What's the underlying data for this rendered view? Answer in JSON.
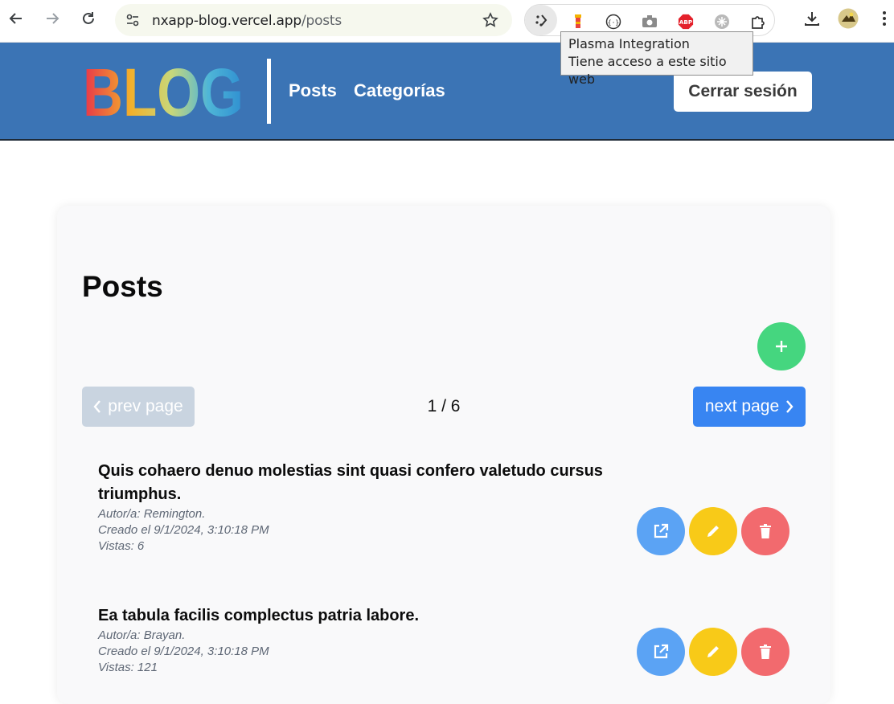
{
  "browser": {
    "url_host": "nxapp-blog.vercel.app",
    "url_path": "/posts",
    "tooltip_title": "Plasma Integration",
    "tooltip_desc": "Tiene acceso a este sitio web"
  },
  "header": {
    "logo_text": "BLOG",
    "nav": [
      "Posts",
      "Categorías"
    ],
    "logout_label": "Cerrar sesión"
  },
  "main": {
    "title": "Posts",
    "pagination": {
      "prev_label": "prev page",
      "next_label": "next page",
      "indicator": "1 / 6"
    },
    "posts": [
      {
        "title": "Quis cohaero denuo molestias sint quasi confero valetudo cursus triumphus.",
        "author": "Autor/a: Remington.",
        "created": "Creado el 9/1/2024, 3:10:18 PM",
        "views": "Vistas: 6"
      },
      {
        "title": "Ea tabula facilis complectus patria labore.",
        "author": "Autor/a: Brayan.",
        "created": "Creado el 9/1/2024, 3:10:18 PM",
        "views": "Vistas: 121"
      }
    ]
  },
  "colors": {
    "header_bg": "#3b74b5",
    "add": "#45d67f",
    "next": "#3885f2",
    "prev": "#c9d4e0",
    "view": "#5ba3f4",
    "edit": "#f8ca18",
    "delete": "#f26a6e"
  }
}
